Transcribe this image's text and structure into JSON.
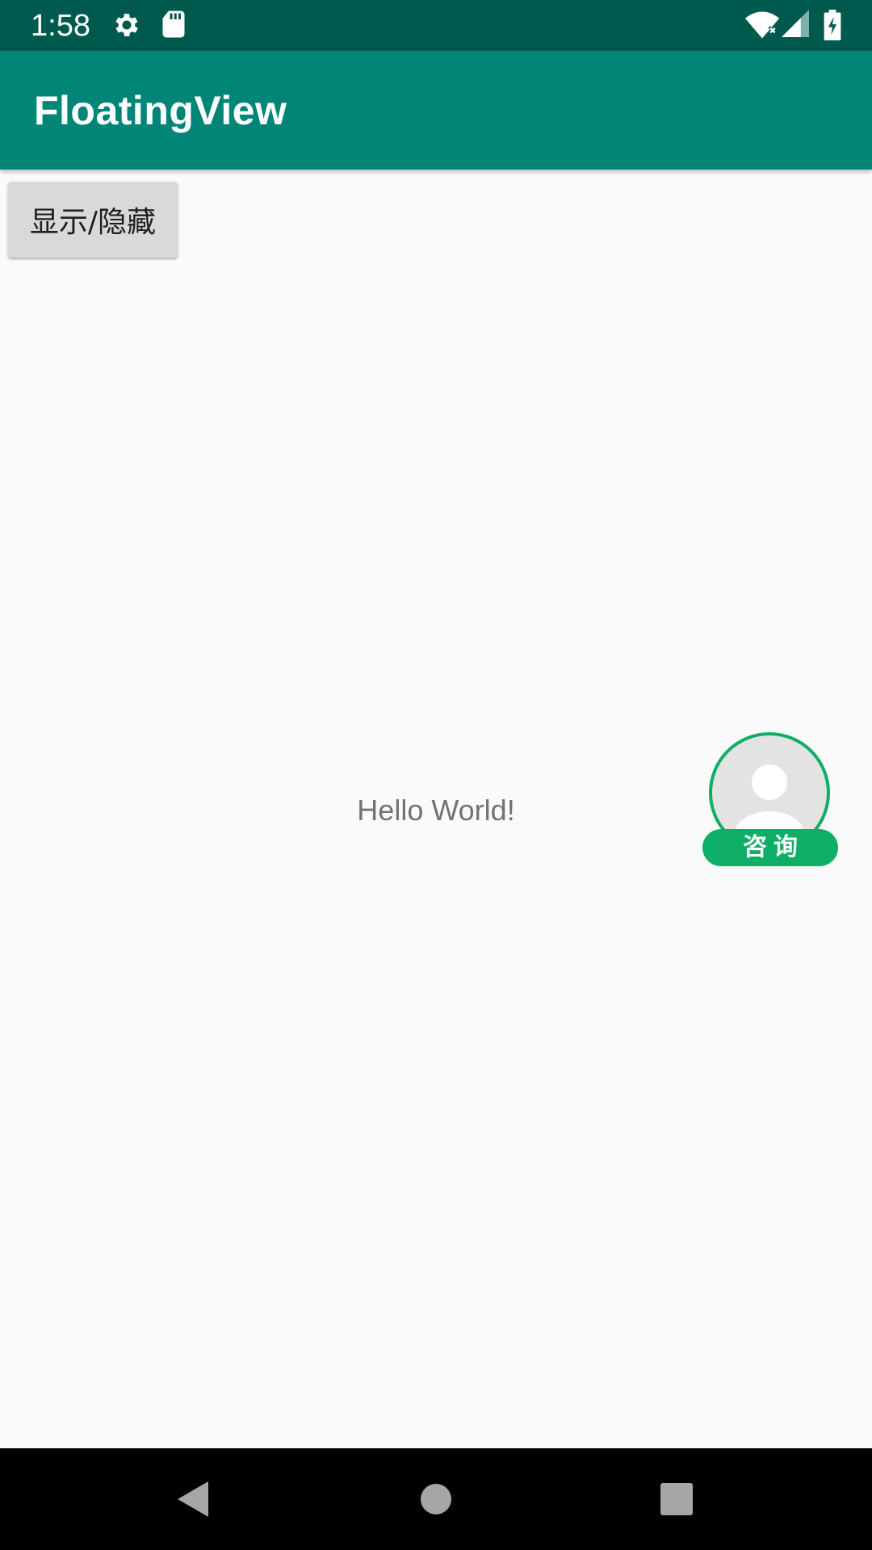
{
  "status_bar": {
    "time": "1:58",
    "icons": [
      "gear-icon",
      "sd-card-icon",
      "wifi-icon",
      "signal-icon",
      "battery-charging-icon"
    ]
  },
  "app_bar": {
    "title": "FloatingView"
  },
  "main": {
    "toggle_button_label": "显示/隐藏",
    "hello_text": "Hello World!"
  },
  "floating_view": {
    "label": "咨询",
    "avatar_icon": "person-icon"
  },
  "nav_bar": {
    "buttons": [
      "back-icon",
      "home-icon",
      "recents-icon"
    ]
  },
  "colors": {
    "status_bar": "#00594d",
    "app_bar": "#008577",
    "accent_green": "#0fae67",
    "background": "#fafafa"
  }
}
